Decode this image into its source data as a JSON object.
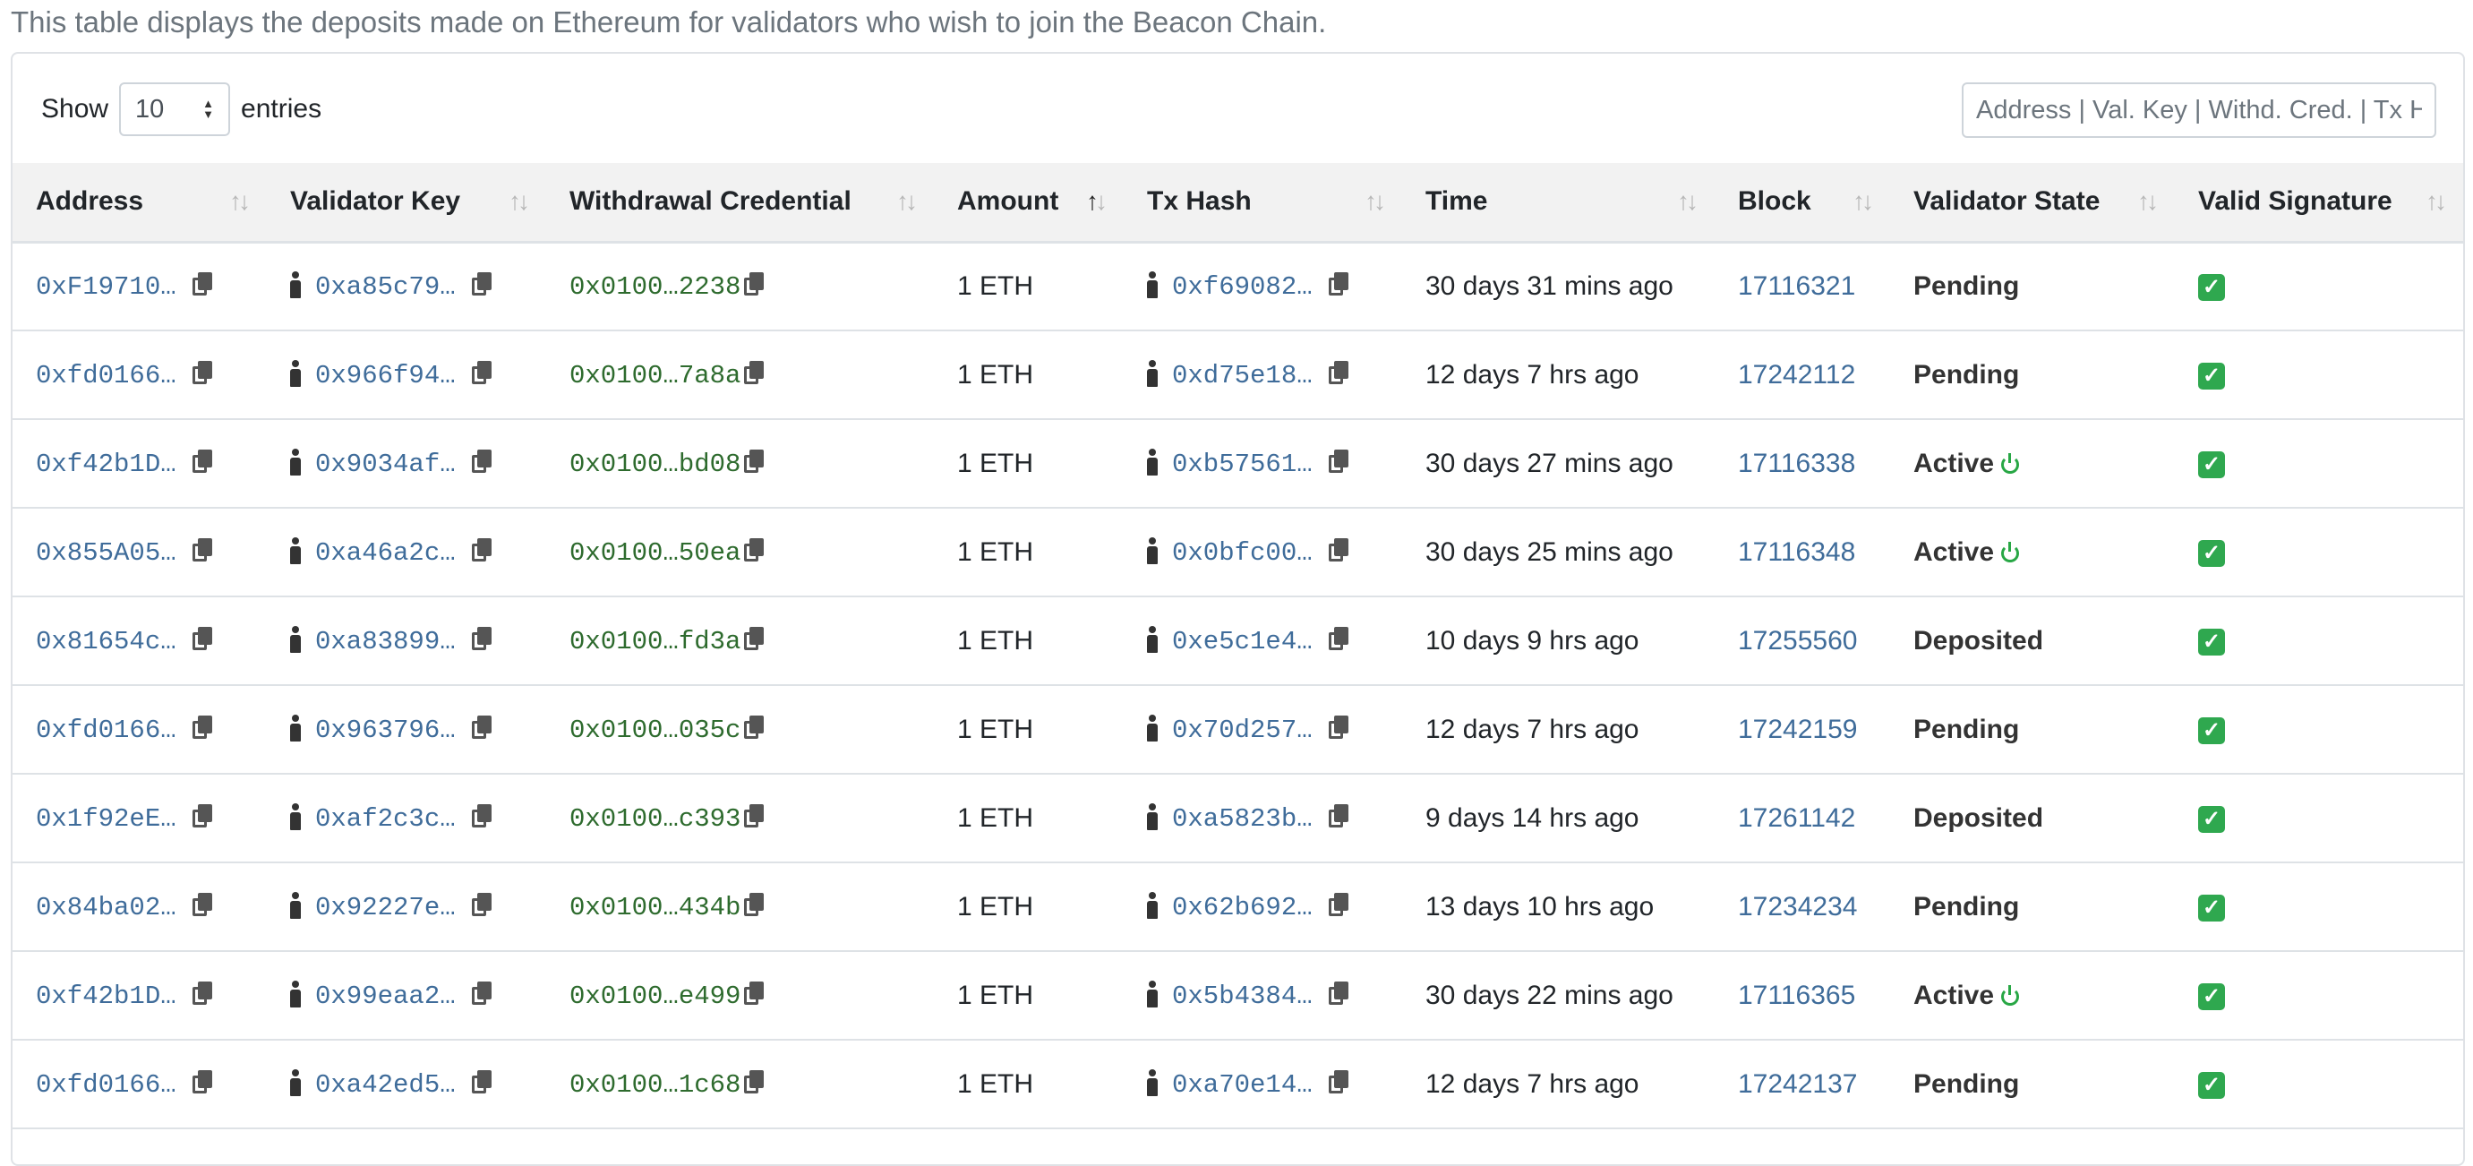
{
  "intro_text": "This table displays the deposits made on Ethereum for validators who wish to join the Beacon Chain.",
  "length_control": {
    "show_label": "Show",
    "selected": "10",
    "entries_label": "entries"
  },
  "search": {
    "placeholder": "Address | Val. Key | Withd. Cred. | Tx Hash"
  },
  "columns": [
    "Address",
    "Validator Key",
    "Withdrawal Credential",
    "Amount",
    "Tx Hash",
    "Time",
    "Block",
    "Validator State",
    "Valid Signature"
  ],
  "sorted_column": "Amount",
  "status_colors": {
    "active_icon": "#28a745",
    "valid_signature": "#2fa84f",
    "link": "#3f6c9a",
    "credential": "#2e6b2e"
  },
  "rows": [
    {
      "address": "0xF19710…",
      "validator_key": "0xa85c79…",
      "withdrawal_credential": "0x0100…2238",
      "amount": "1 ETH",
      "tx_hash": "0xf69082…",
      "time": "30 days 31 mins ago",
      "block": "17116321",
      "state": "Pending",
      "valid": "✓"
    },
    {
      "address": "0xfd0166…",
      "validator_key": "0x966f94…",
      "withdrawal_credential": "0x0100…7a8a",
      "amount": "1 ETH",
      "tx_hash": "0xd75e18…",
      "time": "12 days 7 hrs ago",
      "block": "17242112",
      "state": "Pending",
      "valid": "✓"
    },
    {
      "address": "0xf42b1D…",
      "validator_key": "0x9034af…",
      "withdrawal_credential": "0x0100…bd08",
      "amount": "1 ETH",
      "tx_hash": "0xb57561…",
      "time": "30 days 27 mins ago",
      "block": "17116338",
      "state": "Active",
      "valid": "✓"
    },
    {
      "address": "0x855A05…",
      "validator_key": "0xa46a2c…",
      "withdrawal_credential": "0x0100…50ea",
      "amount": "1 ETH",
      "tx_hash": "0x0bfc00…",
      "time": "30 days 25 mins ago",
      "block": "17116348",
      "state": "Active",
      "valid": "✓"
    },
    {
      "address": "0x81654c…",
      "validator_key": "0xa83899…",
      "withdrawal_credential": "0x0100…fd3a",
      "amount": "1 ETH",
      "tx_hash": "0xe5c1e4…",
      "time": "10 days 9 hrs ago",
      "block": "17255560",
      "state": "Deposited",
      "valid": "✓"
    },
    {
      "address": "0xfd0166…",
      "validator_key": "0x963796…",
      "withdrawal_credential": "0x0100…035c",
      "amount": "1 ETH",
      "tx_hash": "0x70d257…",
      "time": "12 days 7 hrs ago",
      "block": "17242159",
      "state": "Pending",
      "valid": "✓"
    },
    {
      "address": "0x1f92eE…",
      "validator_key": "0xaf2c3c…",
      "withdrawal_credential": "0x0100…c393",
      "amount": "1 ETH",
      "tx_hash": "0xa5823b…",
      "time": "9 days 14 hrs ago",
      "block": "17261142",
      "state": "Deposited",
      "valid": "✓"
    },
    {
      "address": "0x84ba02…",
      "validator_key": "0x92227e…",
      "withdrawal_credential": "0x0100…434b",
      "amount": "1 ETH",
      "tx_hash": "0x62b692…",
      "time": "13 days 10 hrs ago",
      "block": "17234234",
      "state": "Pending",
      "valid": "✓"
    },
    {
      "address": "0xf42b1D…",
      "validator_key": "0x99eaa2…",
      "withdrawal_credential": "0x0100…e499",
      "amount": "1 ETH",
      "tx_hash": "0x5b4384…",
      "time": "30 days 22 mins ago",
      "block": "17116365",
      "state": "Active",
      "valid": "✓"
    },
    {
      "address": "0xfd0166…",
      "validator_key": "0xa42ed5…",
      "withdrawal_credential": "0x0100…1c68",
      "amount": "1 ETH",
      "tx_hash": "0xa70e14…",
      "time": "12 days 7 hrs ago",
      "block": "17242137",
      "state": "Pending",
      "valid": "✓"
    }
  ]
}
